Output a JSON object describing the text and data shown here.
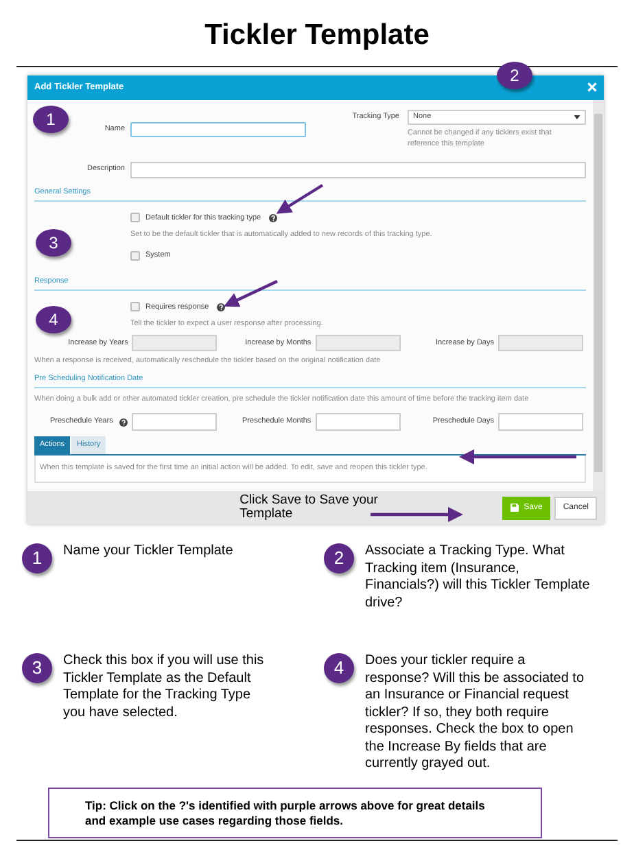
{
  "page_title": "Tickler Template",
  "dialog": {
    "title": "Add Tickler Template",
    "name_label": "Name",
    "tracking_type": {
      "label": "Tracking Type",
      "value": "None",
      "hint": "Cannot be changed if any ticklers exist that reference this template"
    },
    "description_label": "Description",
    "general_settings": {
      "heading": "General Settings",
      "options": [
        {
          "label": "Default tickler for this tracking type",
          "checked": false,
          "help": true,
          "hint": "Set to be the default tickler that is automatically added to new records of this tracking type."
        },
        {
          "label": "System",
          "checked": false,
          "help": false
        }
      ]
    },
    "response": {
      "heading": "Response",
      "option": {
        "label": "Requires response",
        "checked": false,
        "help": true,
        "hint": "Tell the tickler to expect a user response after processing."
      },
      "fields": [
        {
          "label": "Increase by Years",
          "disabled": true
        },
        {
          "label": "Increase by Months",
          "disabled": true
        },
        {
          "label": "Increase by Days",
          "disabled": true
        }
      ],
      "hint": "When a response is received, automatically reschedule the tickler based on the original notification date"
    },
    "pre_scheduling": {
      "heading": "Pre Scheduling Notification Date",
      "hint": "When doing a bulk add or other automated tickler creation, pre schedule the tickler notification date this amount of time before the tracking item date",
      "fields": [
        {
          "label": "Preschedule Years",
          "help": true
        },
        {
          "label": "Preschedule Months",
          "help": false
        },
        {
          "label": "Preschedule Days",
          "help": false
        }
      ]
    },
    "tabs": [
      {
        "label": "Actions",
        "selected": true
      },
      {
        "label": "History",
        "selected": false
      }
    ],
    "tab_text": "When this template is saved for the first time an initial action will be added. To edit, save and reopen this tickler type.",
    "footer_note": "Click Save to Save your Template",
    "buttons": [
      {
        "label": "Save",
        "kind": "primary"
      },
      {
        "label": "Cancel",
        "kind": "secondary"
      }
    ]
  },
  "callouts": [
    "1",
    "2",
    "3",
    "4"
  ],
  "steps": [
    {
      "number": "1",
      "text": "Name your Tickler Template"
    },
    {
      "number": "2",
      "text": "Associate a Tracking Type.  What Tracking item (Insurance, Financials?) will this Tickler Template drive?"
    },
    {
      "number": "3",
      "text": "Check this box if you will use this Tickler Template as the Default Template for the Tracking Type you have selected."
    },
    {
      "number": "4",
      "text": "Does your tickler require a response? Will this be associated to an Insurance or Financial request tickler?  If so, they both require responses.  Check the box to open the Increase By fields that are currently grayed out."
    }
  ],
  "tip": "Tip: Click on the ?'s identified with purple arrows above for great details and example use cases regarding those fields."
}
